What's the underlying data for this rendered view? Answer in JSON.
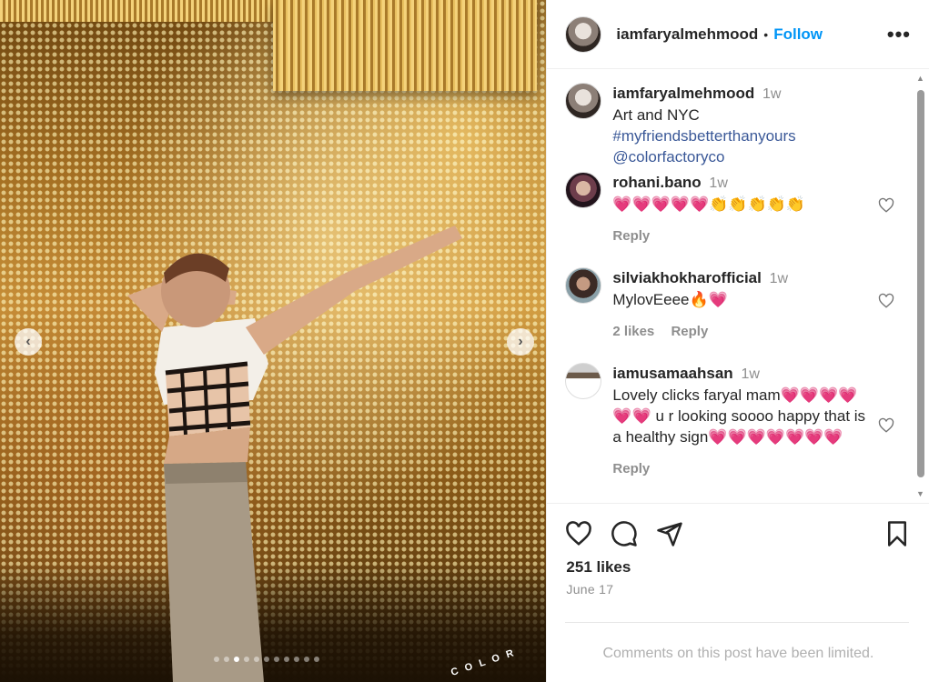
{
  "post": {
    "author": "iamfaryalmehmood",
    "follow_label": "Follow",
    "bullet": "•",
    "more_label": "•••",
    "caption_time": "1w",
    "caption_text": "Art and NYC",
    "caption_hashtag": "#myfriendsbetterthanyours",
    "caption_mention": "@colorfactoryco",
    "likes": "251 likes",
    "date": "June 17",
    "comments_limited": "Comments on this post have been limited."
  },
  "media": {
    "carousel_dots": 11,
    "active_dot": 3,
    "watermark": "COLOR",
    "prev_label": "‹",
    "next_label": "›"
  },
  "comments": [
    {
      "user": "rohani.bano",
      "time": "1w",
      "text": "💗💗💗💗💗👏👏👏👏👏",
      "likes": "",
      "reply": "Reply"
    },
    {
      "user": "silviakhokharofficial",
      "time": "1w",
      "text": "MylovEeee🔥💗",
      "likes": "2 likes",
      "reply": "Reply"
    },
    {
      "user": "iamusamaahsan",
      "time": "1w",
      "text": "Lovely clicks faryal mam💗💗💗💗💗💗 u r looking soooo happy that is a healthy sign💗💗💗💗💗💗💗",
      "likes": "",
      "reply": "Reply"
    }
  ],
  "icons": {
    "like": "heart-icon",
    "comment": "comment-icon",
    "share": "paper-plane-icon",
    "save": "bookmark-icon"
  },
  "colors": {
    "follow": "#0095f6",
    "link": "#3b5998",
    "muted": "#8e8e8e"
  }
}
